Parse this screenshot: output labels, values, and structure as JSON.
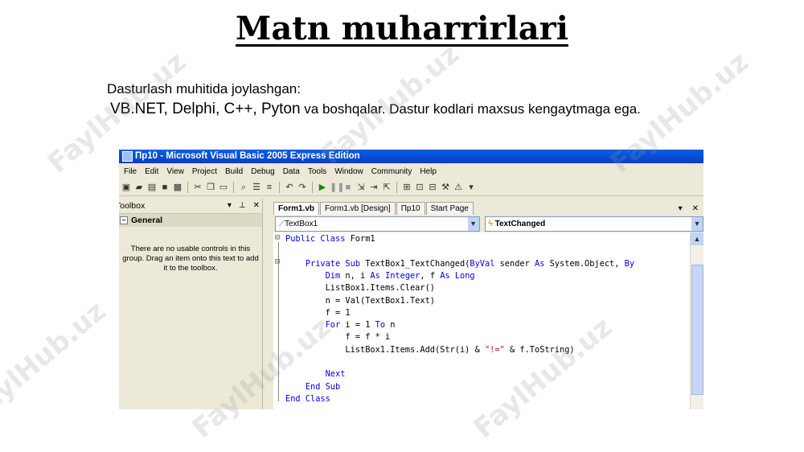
{
  "slide": {
    "title": "Matn muharrirlari",
    "line1": "Dasturlash muhitida joylashgan:",
    "line2_main": "VB.NET, Delphi, C++, Pyton",
    "line2_rest": " va boshqalar. Dastur kodlari maxsus kengaytmaga ega.",
    "watermark": "FaylHub.uz"
  },
  "ide": {
    "title": "Пр10 - Microsoft Visual Basic 2005 Express Edition",
    "menu": [
      "File",
      "Edit",
      "View",
      "Project",
      "Build",
      "Debug",
      "Data",
      "Tools",
      "Window",
      "Community",
      "Help"
    ],
    "toolbox": {
      "header": "Toolbox",
      "group": "General",
      "message": "There are no usable controls in this group. Drag an item onto this text to add it to the toolbox."
    },
    "tabs": [
      "Form1.vb",
      "Form1.vb [Design]",
      "Пр10",
      "Start Page"
    ],
    "object_selector": "TextBox1",
    "event_selector": "TextChanged",
    "code_lines": [
      {
        "parts": [
          {
            "t": "Public Class",
            "c": "kw"
          },
          {
            "t": " Form1"
          }
        ]
      },
      {
        "parts": []
      },
      {
        "parts": [
          {
            "t": "    "
          },
          {
            "t": "Private Sub",
            "c": "kw"
          },
          {
            "t": " TextBox1_TextChanged("
          },
          {
            "t": "ByVal",
            "c": "kw"
          },
          {
            "t": " sender "
          },
          {
            "t": "As",
            "c": "kw"
          },
          {
            "t": " System.Object, "
          },
          {
            "t": "By",
            "c": "kw"
          }
        ]
      },
      {
        "parts": [
          {
            "t": "        "
          },
          {
            "t": "Dim",
            "c": "kw"
          },
          {
            "t": " n, i "
          },
          {
            "t": "As Integer",
            "c": "kw"
          },
          {
            "t": ", f "
          },
          {
            "t": "As Long",
            "c": "kw"
          }
        ]
      },
      {
        "parts": [
          {
            "t": "        ListBox1.Items.Clear()"
          }
        ]
      },
      {
        "parts": [
          {
            "t": "        n = Val(TextBox1.Text)"
          }
        ]
      },
      {
        "parts": [
          {
            "t": "        f = 1"
          }
        ]
      },
      {
        "parts": [
          {
            "t": "        "
          },
          {
            "t": "For",
            "c": "kw"
          },
          {
            "t": " i = 1 "
          },
          {
            "t": "To",
            "c": "kw"
          },
          {
            "t": " n"
          }
        ]
      },
      {
        "parts": [
          {
            "t": "            f = f * i"
          }
        ]
      },
      {
        "parts": [
          {
            "t": "            ListBox1.Items.Add(Str(i) & "
          },
          {
            "t": "\"!=\"",
            "c": "str"
          },
          {
            "t": " & f.ToString)"
          }
        ]
      },
      {
        "parts": []
      },
      {
        "parts": [
          {
            "t": "        "
          },
          {
            "t": "Next",
            "c": "kw"
          }
        ]
      },
      {
        "parts": [
          {
            "t": "    "
          },
          {
            "t": "End Sub",
            "c": "kw"
          }
        ]
      },
      {
        "parts": [
          {
            "t": "End Class",
            "c": "kw"
          }
        ]
      }
    ]
  }
}
